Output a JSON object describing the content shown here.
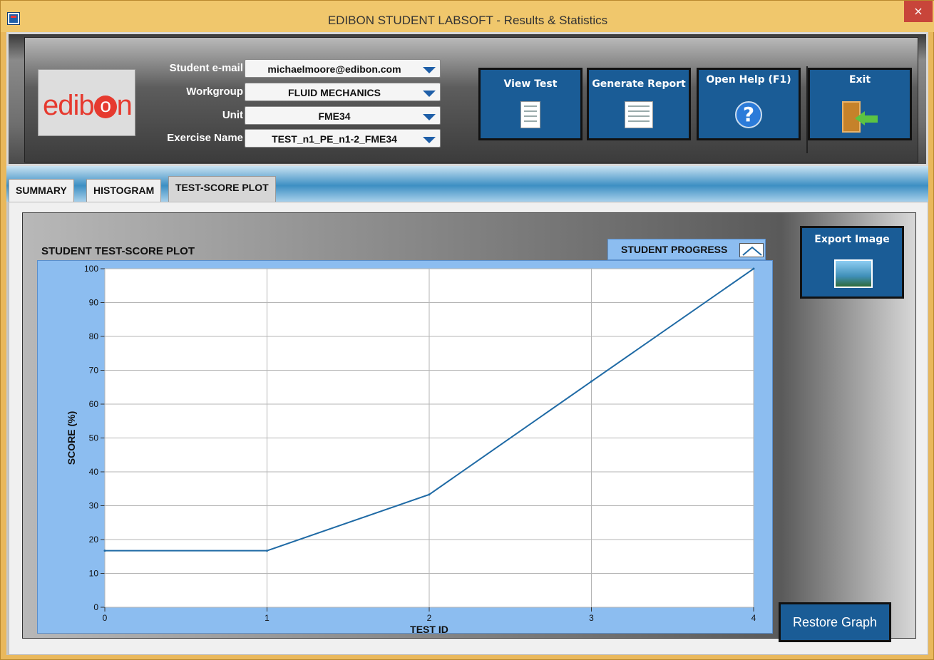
{
  "window": {
    "title": "EDIBON STUDENT LABSOFT - Results & Statistics",
    "close_glyph": "×"
  },
  "logo": {
    "text_left": "edib",
    "text_circle": "o",
    "text_right": "n"
  },
  "fields": [
    {
      "label": "Student e-mail",
      "value": "michaelmoore@edibon.com"
    },
    {
      "label": "Workgroup",
      "value": "FLUID MECHANICS"
    },
    {
      "label": "Unit",
      "value": "FME34"
    },
    {
      "label": "Exercise Name",
      "value": "TEST_n1_PE_n1-2_FME34"
    }
  ],
  "buttons": {
    "view_test": "View Test",
    "generate_report": "Generate Report",
    "open_help": "Open Help (F1)",
    "help_glyph": "?",
    "exit": "Exit",
    "export_image": "Export Image",
    "restore_graph": "Restore Graph"
  },
  "tabs": [
    {
      "label": "SUMMARY",
      "active": false
    },
    {
      "label": "HISTOGRAM",
      "active": false
    },
    {
      "label": "TEST-SCORE PLOT",
      "active": true
    }
  ],
  "plot": {
    "title": "STUDENT TEST-SCORE PLOT",
    "legend_label": "STUDENT PROGRESS"
  },
  "chart_data": {
    "type": "line",
    "xlabel": "TEST ID",
    "ylabel": "SCORE (%)",
    "xlim": [
      0,
      4
    ],
    "ylim": [
      0,
      100
    ],
    "x_ticks": [
      0,
      1,
      2,
      3,
      4
    ],
    "y_ticks": [
      0,
      10,
      20,
      30,
      40,
      50,
      60,
      70,
      80,
      90,
      100
    ],
    "grid": true,
    "line_color": "#1f6aa5",
    "series": [
      {
        "name": "STUDENT PROGRESS",
        "x": [
          0,
          1,
          2,
          3,
          4
        ],
        "y": [
          16.7,
          16.7,
          33.3,
          66.7,
          100
        ]
      }
    ]
  }
}
